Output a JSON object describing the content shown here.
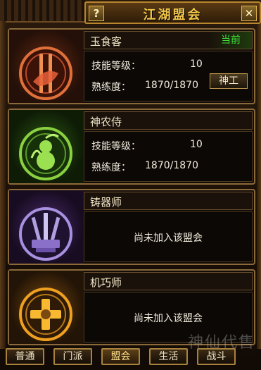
{
  "window": {
    "title": "江湖盟会",
    "help_label": "?",
    "close_label": "✕"
  },
  "guilds": [
    {
      "name": "玉食客",
      "status_badge": "当前",
      "skill_label": "技能等级：",
      "skill_value": "10",
      "prof_label": "熟练度：",
      "prof_value": "1870/1870",
      "button_label": "神工",
      "emblem": "chef-emblem-icon",
      "accent": "#c8502a"
    },
    {
      "name": "神农侍",
      "skill_label": "技能等级：",
      "skill_value": "10",
      "prof_label": "熟练度：",
      "prof_value": "1870/1870",
      "emblem": "herb-gourd-emblem-icon",
      "accent": "#7ac83a"
    },
    {
      "name": "铸器师",
      "not_joined_text": "尚未加入该盟会",
      "emblem": "forge-weapons-emblem-icon",
      "accent": "#a890e0"
    },
    {
      "name": "机巧师",
      "not_joined_text": "尚未加入该盟会",
      "emblem": "gear-mechanism-emblem-icon",
      "accent": "#f0a020"
    }
  ],
  "tabs": [
    {
      "label": "普通"
    },
    {
      "label": "门派"
    },
    {
      "label": "盟会"
    },
    {
      "label": "生活"
    },
    {
      "label": "战斗"
    }
  ],
  "watermark": "神仙代售"
}
